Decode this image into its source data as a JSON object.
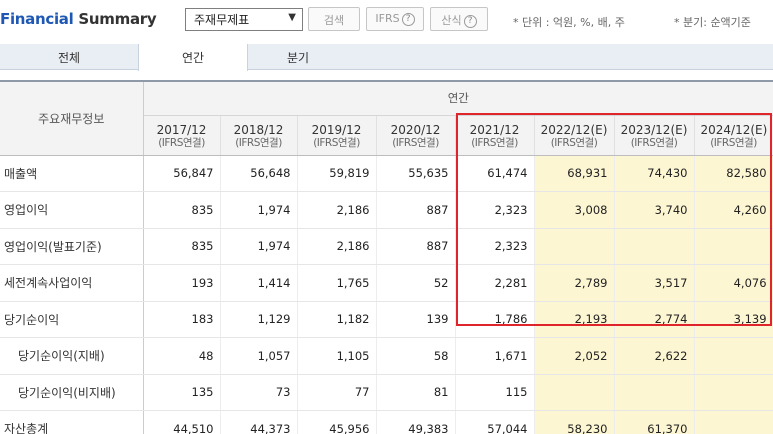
{
  "header": {
    "title_brand": "Financial",
    "title_rest": "Summary",
    "report_select": "주재무제표",
    "search_button": "검색",
    "ifrs_button": "IFRS",
    "formula_button": "산식",
    "help_glyph": "?",
    "unit_note": "* 단위 : 억원, %, 배, 주",
    "quarter_note": "* 분기: 순액기준"
  },
  "tabs": [
    "전체",
    "연간",
    "분기"
  ],
  "table": {
    "row_header": "주요재무정보",
    "group_header": "연간",
    "columns": [
      {
        "year": "2017/12",
        "basis": "(IFRS연결)"
      },
      {
        "year": "2018/12",
        "basis": "(IFRS연결)"
      },
      {
        "year": "2019/12",
        "basis": "(IFRS연결)"
      },
      {
        "year": "2020/12",
        "basis": "(IFRS연결)"
      },
      {
        "year": "2021/12",
        "basis": "(IFRS연결)"
      },
      {
        "year": "2022/12(E)",
        "basis": "(IFRS연결)"
      },
      {
        "year": "2023/12(E)",
        "basis": "(IFRS연결)"
      },
      {
        "year": "2024/12(E)",
        "basis": "(IFRS연결)"
      }
    ],
    "rows": [
      {
        "label": "매출액",
        "values": [
          "56,847",
          "56,648",
          "59,819",
          "55,635",
          "61,474",
          "68,931",
          "74,430",
          "82,580"
        ]
      },
      {
        "label": "영업이익",
        "values": [
          "835",
          "1,974",
          "2,186",
          "887",
          "2,323",
          "3,008",
          "3,740",
          "4,260"
        ]
      },
      {
        "label": "영업이익(발표기준)",
        "values": [
          "835",
          "1,974",
          "2,186",
          "887",
          "2,323",
          "",
          "",
          ""
        ]
      },
      {
        "label": "세전계속사업이익",
        "values": [
          "193",
          "1,414",
          "1,765",
          "52",
          "2,281",
          "2,789",
          "3,517",
          "4,076"
        ]
      },
      {
        "label": "당기순이익",
        "values": [
          "183",
          "1,129",
          "1,182",
          "139",
          "1,786",
          "2,193",
          "2,774",
          "3,139"
        ]
      },
      {
        "label": "당기순이익(지배)",
        "values": [
          "48",
          "1,057",
          "1,105",
          "58",
          "1,671",
          "2,052",
          "2,622",
          ""
        ]
      },
      {
        "label": "당기순이익(비지배)",
        "values": [
          "135",
          "73",
          "77",
          "81",
          "115",
          "",
          "",
          ""
        ]
      },
      {
        "label": "자산총계",
        "values": [
          "44,510",
          "44,373",
          "45,956",
          "49,383",
          "57,044",
          "58,230",
          "61,370",
          ""
        ]
      }
    ]
  },
  "colors": {
    "brand": "#1e58b4",
    "estimate_bg": "#fdf6d3",
    "highlight": "#e0242b"
  }
}
